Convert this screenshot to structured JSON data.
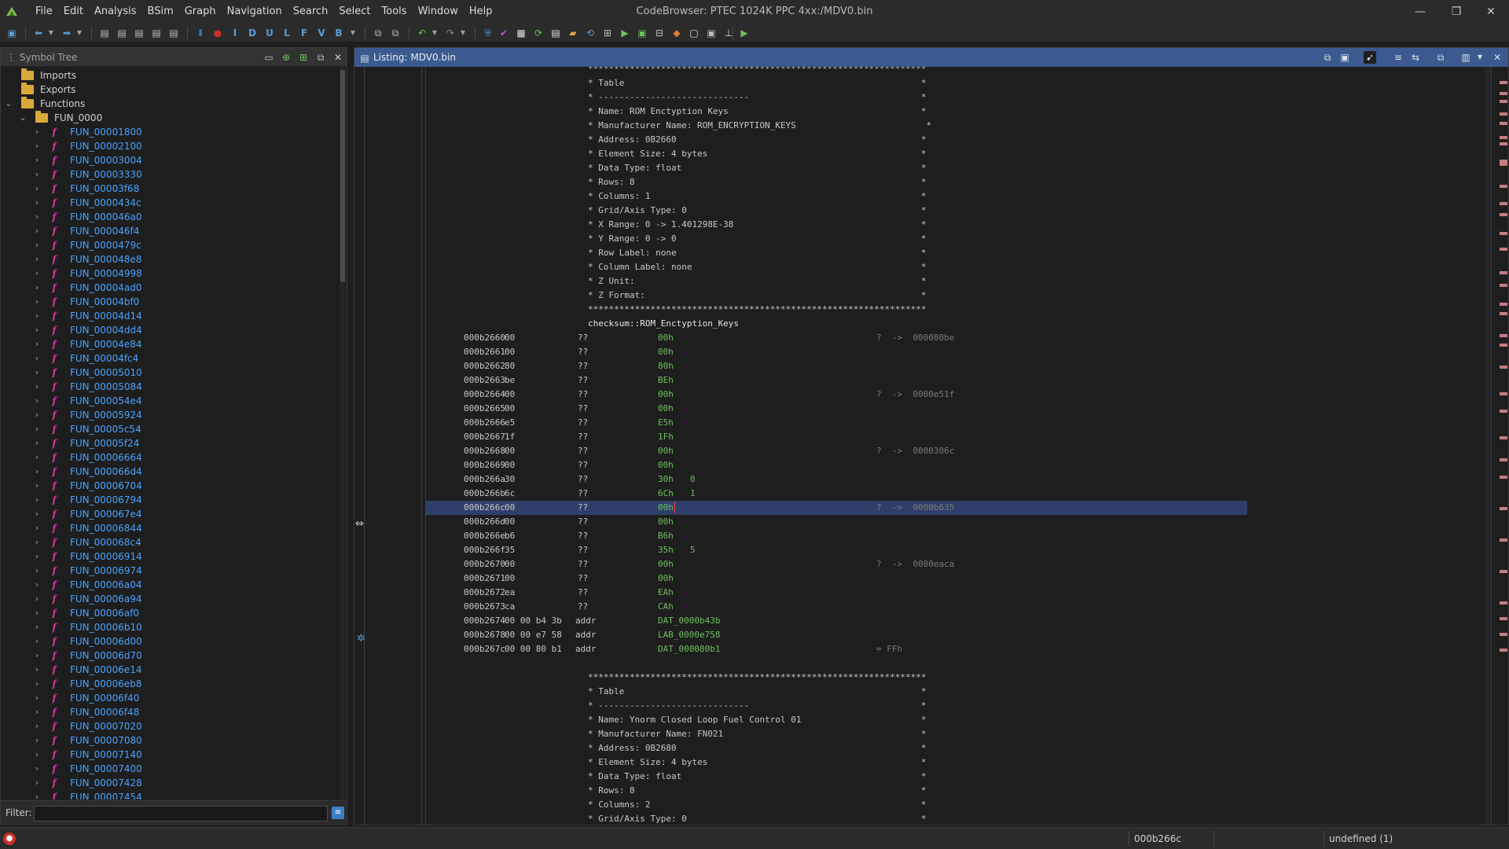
{
  "app": {
    "window_title": "CodeBrowser: PTEC 1024K PPC 4xx:/MDV0.bin",
    "menu": [
      "File",
      "Edit",
      "Analysis",
      "BSim",
      "Graph",
      "Navigation",
      "Search",
      "Select",
      "Tools",
      "Window",
      "Help"
    ],
    "window_controls": {
      "minimize": "—",
      "restore": "❐",
      "close": "✕"
    }
  },
  "toolbar": {
    "icons": [
      "save-icon",
      "back-icon",
      "forward-icon",
      "disassemble-icon",
      "clear-icon",
      "instruction-icon",
      "data-icon",
      "undefined-icon",
      "label-icon",
      "function-icon",
      "variable-icon",
      "bookmark-icon",
      "undo-icon",
      "redo-icon",
      "memory-icon",
      "check-icon",
      "run-icon"
    ],
    "letters": {
      "i": "I",
      "d": "D",
      "u": "U",
      "l": "L",
      "f": "F",
      "v": "V",
      "b": "B"
    }
  },
  "symbol_tree": {
    "title": "Symbol Tree",
    "imports": "Imports",
    "exports": "Exports",
    "functions": "Functions",
    "folder": "FUN_0000",
    "items": [
      "FUN_00001800",
      "FUN_00002100",
      "FUN_00003004",
      "FUN_00003330",
      "FUN_00003f68",
      "FUN_0000434c",
      "FUN_000046a0",
      "FUN_000046f4",
      "FUN_0000479c",
      "FUN_000048e8",
      "FUN_00004998",
      "FUN_00004ad0",
      "FUN_00004bf0",
      "FUN_00004d14",
      "FUN_00004dd4",
      "FUN_00004e84",
      "FUN_00004fc4",
      "FUN_00005010",
      "FUN_00005084",
      "FUN_000054e4",
      "FUN_00005924",
      "FUN_00005c54",
      "FUN_00005f24",
      "FUN_00006664",
      "FUN_000066d4",
      "FUN_00006704",
      "FUN_00006794",
      "FUN_000067e4",
      "FUN_00006844",
      "FUN_000068c4",
      "FUN_00006914",
      "FUN_00006974",
      "FUN_00006a04",
      "FUN_00006a94",
      "FUN_00006af0",
      "FUN_00006b10",
      "FUN_00006d00",
      "FUN_00006d70",
      "FUN_00006e14",
      "FUN_00006eb8",
      "FUN_00006f40",
      "FUN_00006f48",
      "FUN_00007020",
      "FUN_00007080",
      "FUN_00007140",
      "FUN_00007400",
      "FUN_00007428",
      "FUN_00007454"
    ],
    "filter_label": "Filter:",
    "filter_value": ""
  },
  "listing": {
    "title": "Listing:  MDV0.bin",
    "header_block_1": [
      "*****************************************************************",
      "* Table                                                         *",
      "* -----------------------------                                 *",
      "* Name: ROM Enctyption Keys                                     *",
      "* Manufacturer Name: ROM_ENCRYPTION_KEYS                         *",
      "* Address: 0B2660                                               *",
      "* Element Size: 4 bytes                                         *",
      "* Data Type: float                                              *",
      "* Rows: 8                                                       *",
      "* Columns: 1                                                    *",
      "* Grid/Axis Type: 0                                             *",
      "* X Range: 0 -> 1.401298E-38                                    *",
      "* Y Range: 0 -> 0                                               *",
      "* Row Label: none                                               *",
      "* Column Label: none                                            *",
      "* Z Unit:                                                       *",
      "* Z Format:                                                     *",
      "*****************************************************************"
    ],
    "label": "checksum::ROM_Enctyption_Keys",
    "rows": [
      {
        "addr": "000b2660",
        "bytes": "00",
        "mnem": "??",
        "val": "00h",
        "idx": "",
        "xref": "?  ->  000080be"
      },
      {
        "addr": "000b2661",
        "bytes": "00",
        "mnem": "??",
        "val": "00h",
        "idx": "",
        "xref": ""
      },
      {
        "addr": "000b2662",
        "bytes": "80",
        "mnem": "??",
        "val": "80h",
        "idx": "",
        "xref": ""
      },
      {
        "addr": "000b2663",
        "bytes": "be",
        "mnem": "??",
        "val": "BEh",
        "idx": "",
        "xref": ""
      },
      {
        "addr": "000b2664",
        "bytes": "00",
        "mnem": "??",
        "val": "00h",
        "idx": "",
        "xref": "?  ->  0000e51f"
      },
      {
        "addr": "000b2665",
        "bytes": "00",
        "mnem": "??",
        "val": "00h",
        "idx": "",
        "xref": ""
      },
      {
        "addr": "000b2666",
        "bytes": "e5",
        "mnem": "??",
        "val": "E5h",
        "idx": "",
        "xref": ""
      },
      {
        "addr": "000b2667",
        "bytes": "1f",
        "mnem": "??",
        "val": "1Fh",
        "idx": "",
        "xref": ""
      },
      {
        "addr": "000b2668",
        "bytes": "00",
        "mnem": "??",
        "val": "00h",
        "idx": "",
        "xref": "?  ->  0000306c"
      },
      {
        "addr": "000b2669",
        "bytes": "00",
        "mnem": "??",
        "val": "00h",
        "idx": "",
        "xref": ""
      },
      {
        "addr": "000b266a",
        "bytes": "30",
        "mnem": "??",
        "val": "30h",
        "idx": "0",
        "xref": ""
      },
      {
        "addr": "000b266b",
        "bytes": "6c",
        "mnem": "??",
        "val": "6Ch",
        "idx": "1",
        "xref": ""
      },
      {
        "addr": "000b266c",
        "bytes": "00",
        "mnem": "??",
        "val": "00h",
        "idx": "",
        "xref": "?  ->  0000b635"
      },
      {
        "addr": "000b266d",
        "bytes": "00",
        "mnem": "??",
        "val": "00h",
        "idx": "",
        "xref": ""
      },
      {
        "addr": "000b266e",
        "bytes": "b6",
        "mnem": "??",
        "val": "B6h",
        "idx": "",
        "xref": ""
      },
      {
        "addr": "000b266f",
        "bytes": "35",
        "mnem": "??",
        "val": "35h",
        "idx": "5",
        "xref": ""
      },
      {
        "addr": "000b2670",
        "bytes": "00",
        "mnem": "??",
        "val": "00h",
        "idx": "",
        "xref": "?  ->  0000eaca"
      },
      {
        "addr": "000b2671",
        "bytes": "00",
        "mnem": "??",
        "val": "00h",
        "idx": "",
        "xref": ""
      },
      {
        "addr": "000b2672",
        "bytes": "ea",
        "mnem": "??",
        "val": "EAh",
        "idx": "",
        "xref": ""
      },
      {
        "addr": "000b2673",
        "bytes": "ca",
        "mnem": "??",
        "val": "CAh",
        "idx": "",
        "xref": ""
      },
      {
        "addr": "000b2674",
        "bytes": "00 00 b4 3b",
        "mnem": "addr",
        "val": "DAT_0000b43b",
        "idx": "",
        "xref": ""
      },
      {
        "addr": "000b2678",
        "bytes": "00 00 e7 58",
        "mnem": "addr",
        "val": "LAB_0000e758",
        "idx": "",
        "xref": ""
      },
      {
        "addr": "000b267c",
        "bytes": "00 00 80 b1",
        "mnem": "addr",
        "val": "DAT_000080b1",
        "idx": "",
        "xref": "= FFh"
      }
    ],
    "selected_row": 12,
    "header_block_2": [
      "*****************************************************************",
      "* Table                                                         *",
      "* -----------------------------                                 *",
      "* Name: Ynorm Closed Loop Fuel Control 01                       *",
      "* Manufacturer Name: FN021                                      *",
      "* Address: 0B2680                                               *",
      "* Element Size: 4 bytes                                         *",
      "* Data Type: float                                              *",
      "* Rows: 8                                                       *",
      "* Columns: 2                                                    *",
      "* Grid/Axis Type: 0                                             *"
    ]
  },
  "status": {
    "address": "000b266c",
    "blank": "",
    "data_type": "undefined (1)"
  },
  "colors": {
    "background": "#1e1e1e",
    "panel_header": "#333333",
    "listing_header": "#3b5a8f",
    "selection": "#2f3f6a",
    "function_link": "#4aa3ff",
    "value": "#6ec05e",
    "xref": "#7b7b7b"
  }
}
